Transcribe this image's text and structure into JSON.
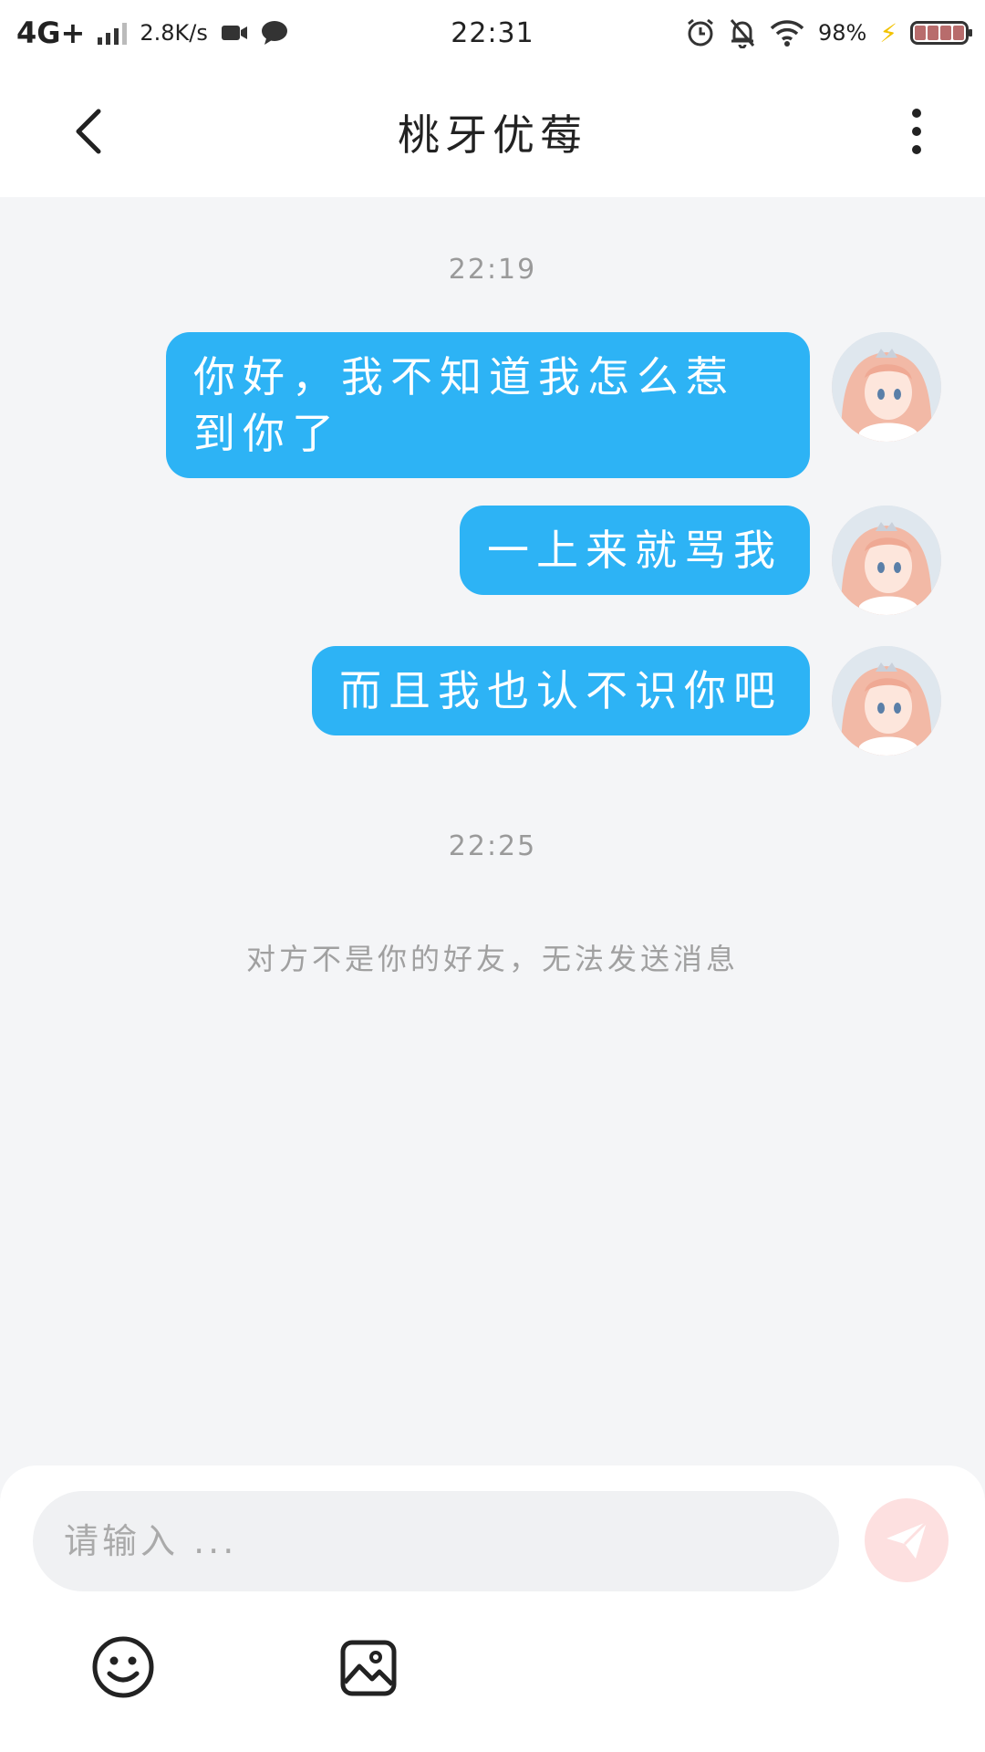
{
  "status_bar": {
    "network": "4G+",
    "speed": "2.8K/s",
    "time": "22:31",
    "battery": "98%",
    "icons": [
      "signal-icon",
      "video-icon",
      "chat-bubble-icon",
      "alarm-icon",
      "mute-bell-icon",
      "wifi-icon",
      "charging-bolt-icon",
      "battery-icon"
    ]
  },
  "header": {
    "title": "桃牙优莓",
    "back_icon": "chevron-left-icon",
    "more_icon": "more-vertical-icon"
  },
  "chat": {
    "timestamps": [
      "22:19",
      "22:25"
    ],
    "messages": [
      {
        "sender": "self",
        "text": "你好，我不知道我怎么惹到你了"
      },
      {
        "sender": "self",
        "text": "一上来就骂我"
      },
      {
        "sender": "self",
        "text": "而且我也认不识你吧"
      }
    ],
    "system_notice": "对方不是你的好友，无法发送消息"
  },
  "input": {
    "placeholder": "请输入 ...",
    "value": ""
  },
  "toolbar": {
    "send_icon": "paper-plane-icon",
    "emoji_icon": "smiley-icon",
    "image_icon": "image-icon"
  },
  "colors": {
    "bubble": "#2db3f5",
    "background": "#f4f5f7",
    "send_button": "#fde0e0"
  }
}
